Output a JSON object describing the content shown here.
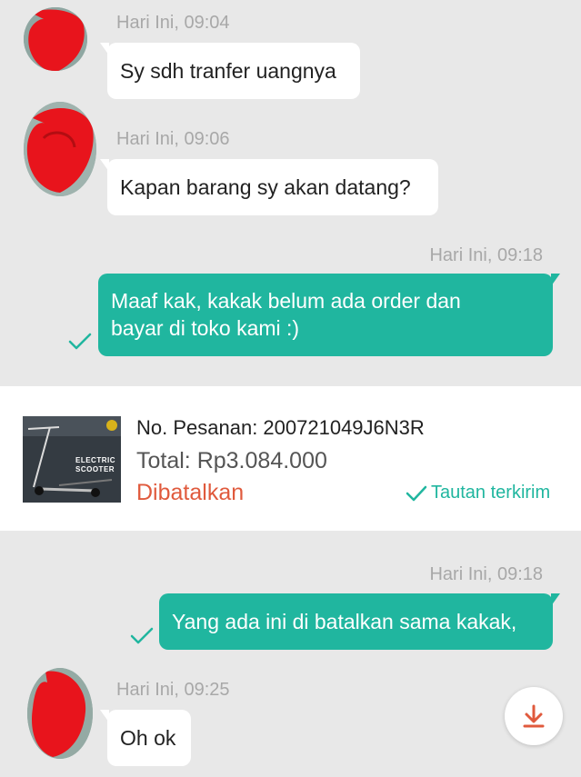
{
  "messages": [
    {
      "timestamp": "Hari Ini, 09:04",
      "text": "Sy sdh tranfer uangnya"
    },
    {
      "timestamp": "Hari Ini, 09:06",
      "text": "Kapan barang sy akan datang?"
    },
    {
      "timestamp": "Hari Ini, 09:18",
      "line1": "Maaf kak, kakak belum ada order dan",
      "line2": "bayar di toko kami :)"
    },
    {
      "timestamp": "Hari Ini, 09:18",
      "text": "Yang ada ini di batalkan sama kakak,"
    },
    {
      "timestamp": "Hari Ini, 09:25",
      "text": "Oh ok"
    }
  ],
  "order_card": {
    "order_number": "No. Pesanan: 200721049J6N3R",
    "total": "Total: Rp3.084.000",
    "status": "Dibatalkan",
    "link_status": "Tautan terkirim",
    "thumbnail_text_line1": "ELECTRIC",
    "thumbnail_text_line2": "SCOOTER"
  },
  "colors": {
    "background": "#e8e8e8",
    "outgoing_bubble": "#20b69f",
    "incoming_bubble": "#ffffff",
    "status_cancelled": "#e05a3d",
    "link_status": "#20b69f",
    "redaction": "#e8141c"
  },
  "icons": {
    "avatar": "avatar-icon",
    "check": "check-icon",
    "download": "download-arrow-icon"
  }
}
